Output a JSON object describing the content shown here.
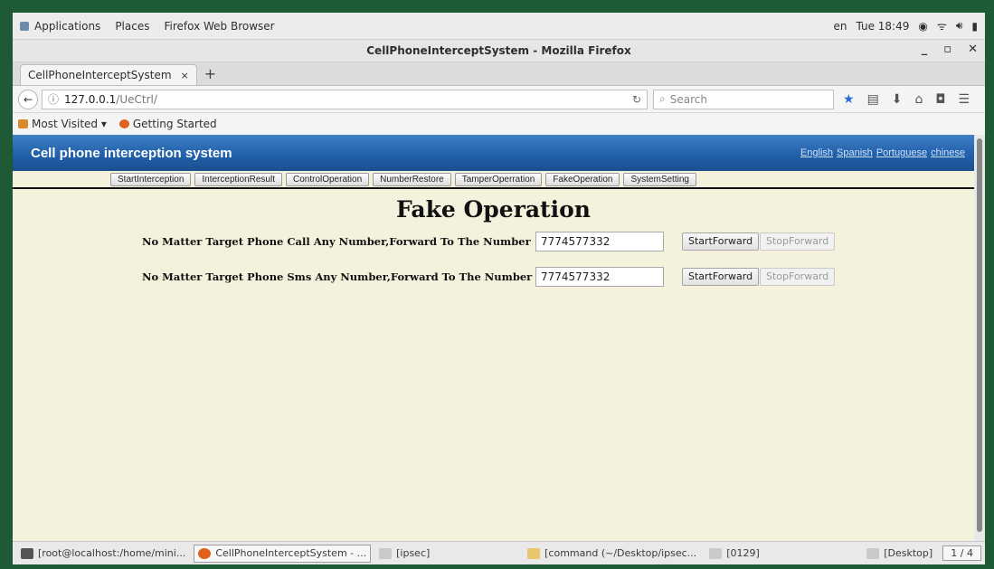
{
  "gnome_bar": {
    "applications": "Applications",
    "places": "Places",
    "firefox": "Firefox Web Browser",
    "lang": "en",
    "clock": "Tue 18:49"
  },
  "window": {
    "title": "CellPhoneInterceptSystem - Mozilla Firefox"
  },
  "tabs": [
    {
      "label": "CellPhoneInterceptSystem",
      "close": "×"
    }
  ],
  "newtab": "+",
  "navbar": {
    "url_host": "127.0.0.1",
    "url_path": "/UeCtrl/",
    "search_placeholder": "Search"
  },
  "bookmarks": [
    {
      "label": "Most Visited ▾"
    },
    {
      "label": "Getting Started"
    }
  ],
  "app": {
    "title": "Cell phone interception system",
    "languages": [
      "English",
      "Spanish",
      "Portuguese",
      "chinese"
    ],
    "menu": [
      "StartInterception",
      "InterceptionResult",
      "ControlOperation",
      "NumberRestore",
      "TamperOperration",
      "FakeOperation",
      "SystemSetting"
    ],
    "page_title": "Fake Operation",
    "rows": [
      {
        "label": "No Matter Target Phone Call Any Number,Forward To The Number",
        "value": "7774577332",
        "start": "StartForward",
        "stop": "StopForward"
      },
      {
        "label": "No Matter Target Phone Sms Any Number,Forward To The Number",
        "value": "7774577332",
        "start": "StartForward",
        "stop": "StopForward"
      }
    ]
  },
  "taskbar": {
    "items": [
      "[root@localhost:/home/mini...",
      "CellPhoneInterceptSystem - ...",
      "[ipsec]",
      "[command (~/Desktop/ipsec...",
      "[0129]",
      "[Desktop]"
    ],
    "pager": "1 / 4"
  }
}
